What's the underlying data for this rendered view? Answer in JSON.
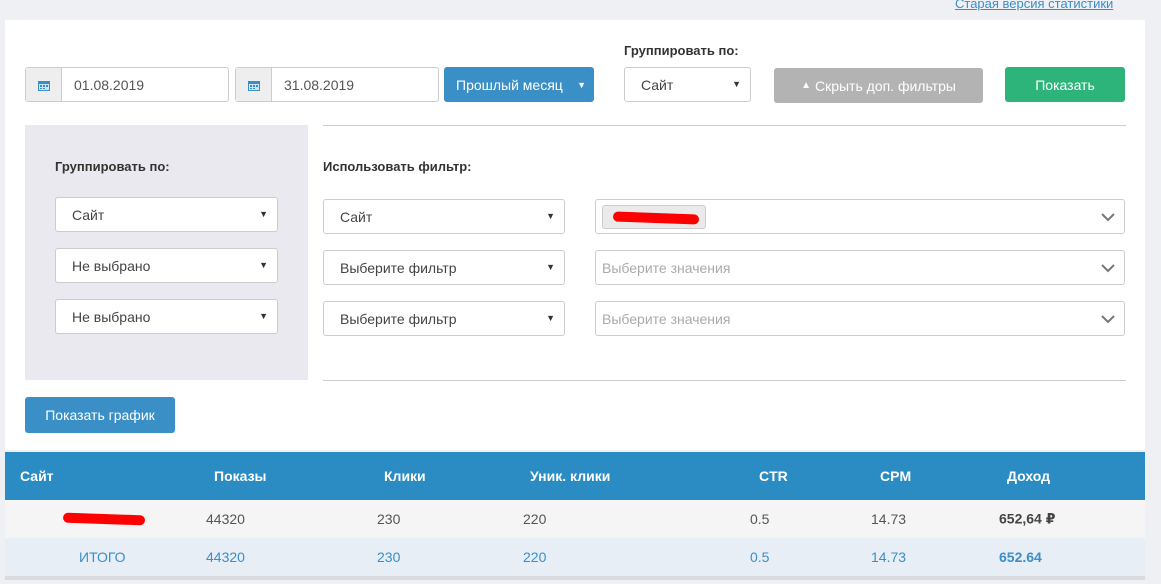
{
  "header": {
    "old_version_link": "Старая версия статистики"
  },
  "toolbar": {
    "date_from": "01.08.2019",
    "date_to": "31.08.2019",
    "period_label": "Прошлый месяц",
    "group_by_label": "Группировать по:",
    "group_by_value": "Сайт",
    "hide_filters_label": "Скрыть доп. фильтры",
    "show_label": "Показать"
  },
  "filters": {
    "group_by_label": "Группировать по:",
    "group_selects": [
      "Сайт",
      "Не выбрано",
      "Не выбрано"
    ],
    "use_filter_label": "Использовать фильтр:",
    "filter_selects": [
      "Сайт",
      "Выберите фильтр",
      "Выберите фильтр"
    ],
    "value_placeholders": [
      "",
      "Выберите значения",
      "Выберите значения"
    ],
    "show_graph_label": "Показать график"
  },
  "table": {
    "columns": [
      "Сайт",
      "Показы",
      "Клики",
      "Уник. клики",
      "CTR",
      "CPM",
      "Доход"
    ],
    "rows": [
      {
        "site": "",
        "impressions": "44320",
        "clicks": "230",
        "unique_clicks": "220",
        "ctr": "0.5",
        "cpm": "14.73",
        "income": "652,64 ₽"
      }
    ],
    "total": {
      "site": "ИТОГО",
      "impressions": "44320",
      "clicks": "230",
      "unique_clicks": "220",
      "ctr": "0.5",
      "cpm": "14.73",
      "income": "652.64"
    }
  },
  "colors": {
    "primary": "#3a8fc7",
    "success": "#2db47a",
    "muted": "#b3b3b3",
    "table_header": "#2a8cc3"
  },
  "icons": [
    "calendar-icon",
    "caret-down-icon",
    "triangle-up-icon",
    "chevron-down-icon"
  ]
}
